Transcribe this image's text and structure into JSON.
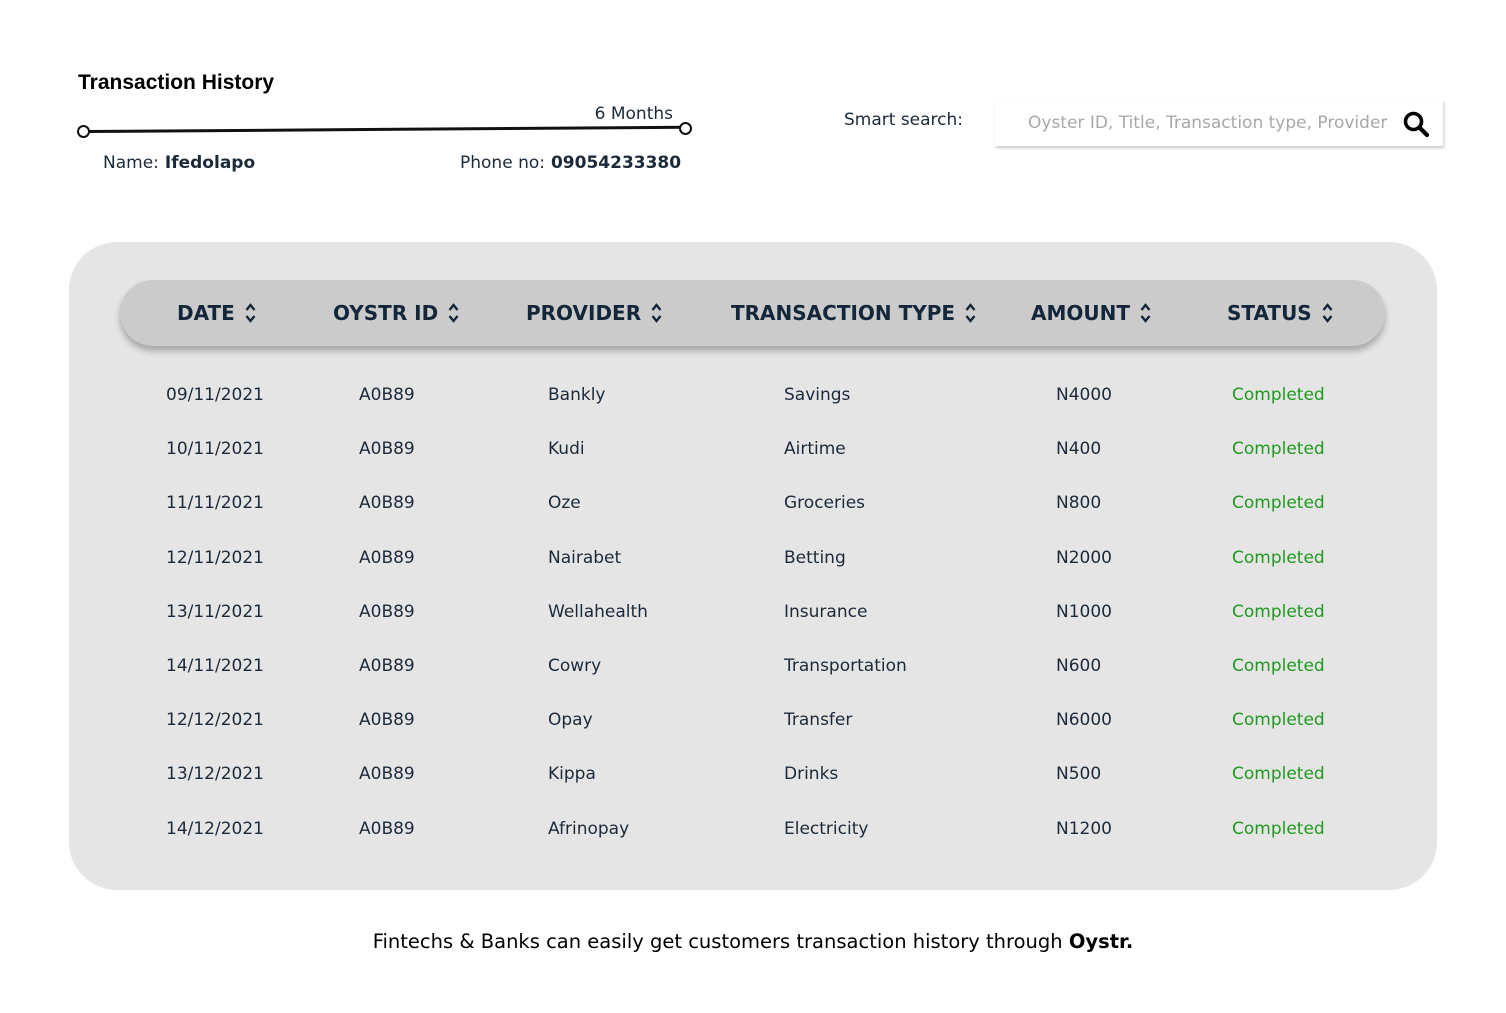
{
  "header": {
    "title": "Transaction History",
    "range_label": "6 Months",
    "name_label": "Name:",
    "name_value": "Ifedolapo",
    "phone_label": "Phone no:",
    "phone_value": "09054233380"
  },
  "search": {
    "label": "Smart search:",
    "placeholder": "Oyster ID, Title, Transaction type, Provider",
    "value": ""
  },
  "table": {
    "columns": [
      "DATE",
      "OYSTR ID",
      "PROVIDER",
      "TRANSACTION TYPE",
      "AMOUNT",
      "STATUS"
    ],
    "rows": [
      {
        "date": "09/11/2021",
        "id": "A0B89",
        "provider": "Bankly",
        "type": "Savings",
        "amount": "N4000",
        "status": "Completed"
      },
      {
        "date": "10/11/2021",
        "id": "A0B89",
        "provider": "Kudi",
        "type": "Airtime",
        "amount": "N400",
        "status": "Completed"
      },
      {
        "date": "11/11/2021",
        "id": "A0B89",
        "provider": "Oze",
        "type": "Groceries",
        "amount": "N800",
        "status": "Completed"
      },
      {
        "date": "12/11/2021",
        "id": "A0B89",
        "provider": "Nairabet",
        "type": "Betting",
        "amount": "N2000",
        "status": "Completed"
      },
      {
        "date": "13/11/2021",
        "id": "A0B89",
        "provider": "Wellahealth",
        "type": "Insurance",
        "amount": "N1000",
        "status": "Completed"
      },
      {
        "date": "14/11/2021",
        "id": "A0B89",
        "provider": "Cowry",
        "type": "Transportation",
        "amount": "N600",
        "status": "Completed"
      },
      {
        "date": "12/12/2021",
        "id": "A0B89",
        "provider": "Opay",
        "type": "Transfer",
        "amount": "N6000",
        "status": "Completed"
      },
      {
        "date": "13/12/2021",
        "id": "A0B89",
        "provider": "Kippa",
        "type": "Drinks",
        "amount": "N500",
        "status": "Completed"
      },
      {
        "date": "14/12/2021",
        "id": "A0B89",
        "provider": "Afrinopay",
        "type": "Electricity",
        "amount": "N1200",
        "status": "Completed"
      }
    ]
  },
  "footer": {
    "text": "Fintechs & Banks can easily get customers transaction history through ",
    "brand": "Oystr."
  },
  "colors": {
    "panel": "#e5e5e5",
    "header_pill": "#cbcbcb",
    "heading_text": "#14263a",
    "status_completed": "#1f9a1f"
  },
  "icons": {
    "search": "search-icon",
    "sort": "sort-icon"
  }
}
